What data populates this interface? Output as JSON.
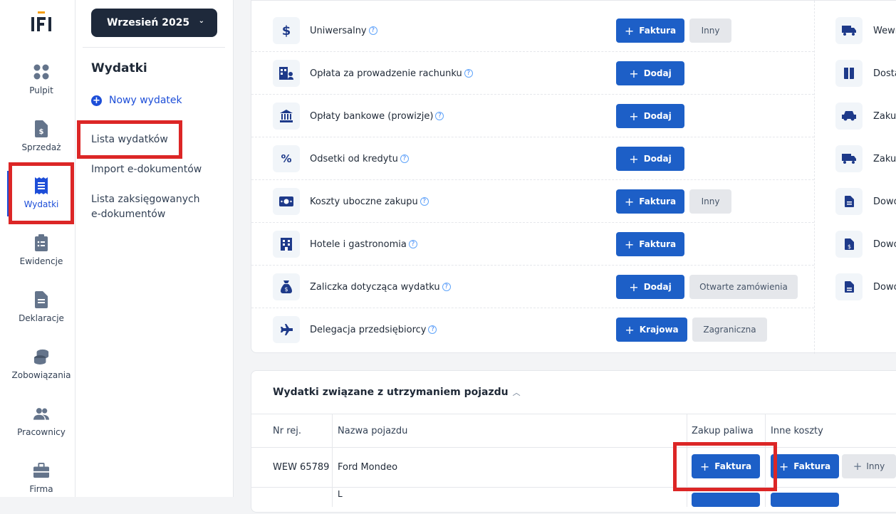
{
  "app": {
    "logo_text": "IFI"
  },
  "colors": {
    "primary": "#1d5fc7",
    "highlight": "#dc2626",
    "dark": "#1e293b"
  },
  "rail": [
    {
      "label": "Pulpit",
      "icon": "dashboard-icon"
    },
    {
      "label": "Sprzedaż",
      "icon": "invoice-dollar-icon"
    },
    {
      "label": "Wydatki",
      "icon": "receipt-icon",
      "active": true
    },
    {
      "label": "Ewidencje",
      "icon": "clipboard-list-icon"
    },
    {
      "label": "Deklaracje",
      "icon": "document-icon"
    },
    {
      "label": "Zobowiązania",
      "icon": "coins-icon"
    },
    {
      "label": "Pracownicy",
      "icon": "users-icon"
    },
    {
      "label": "Firma",
      "icon": "briefcase-icon"
    }
  ],
  "subnav": {
    "month": "Wrzesień 2025",
    "title": "Wydatki",
    "new_expense": "Nowy wydatek",
    "links": [
      "Lista wydatków",
      "Import e-dokumentów",
      "Lista zaksięgowanych e-dokumentów"
    ]
  },
  "expense_types": [
    {
      "name": "Uniwersalny",
      "icon": "dollar-icon",
      "buttons": [
        "Faktura",
        "Inny"
      ]
    },
    {
      "name": "Opłata za prowadzenie rachunku",
      "icon": "building-user-icon",
      "buttons": [
        "Dodaj"
      ]
    },
    {
      "name": "Opłaty bankowe (prowizje)",
      "icon": "bank-icon",
      "buttons": [
        "Dodaj"
      ]
    },
    {
      "name": "Odsetki od kredytu",
      "icon": "percent-icon",
      "buttons": [
        "Dodaj"
      ]
    },
    {
      "name": "Koszty uboczne zakupu",
      "icon": "money-bill-icon",
      "buttons": [
        "Faktura",
        "Inny"
      ]
    },
    {
      "name": "Hotele i gastronomia",
      "icon": "hotel-icon",
      "buttons": [
        "Faktura"
      ]
    },
    {
      "name": "Zaliczka dotycząca wydatku",
      "icon": "money-bag-icon",
      "buttons": [
        "Dodaj",
        "Otwarte zamówienia"
      ]
    },
    {
      "name": "Delegacja przedsiębiorcy",
      "icon": "plane-icon",
      "buttons": [
        "Krajowa",
        "Zagraniczna"
      ]
    }
  ],
  "right_column": [
    {
      "name": "Wewn",
      "icon": "truck-fast-icon"
    },
    {
      "name": "Dosta",
      "icon": "box-icon"
    },
    {
      "name": "Zakup",
      "icon": "car-icon"
    },
    {
      "name": "Zakup",
      "icon": "truck-icon"
    },
    {
      "name": "Dowó",
      "icon": "file-lines-icon"
    },
    {
      "name": "Dowó",
      "icon": "file-dollar-icon"
    },
    {
      "name": "Dowó",
      "icon": "file-icon"
    }
  ],
  "vehicles": {
    "title": "Wydatki związane z utrzymaniem pojazdu",
    "columns": [
      "Nr rej.",
      "Nazwa pojazdu",
      "Zakup paliwa",
      "Inne koszty"
    ],
    "rows": [
      {
        "reg": "WEW 65789",
        "name": "Ford Mondeo",
        "fuel_btn": "Faktura",
        "other_btn": "Faktura",
        "other_btn2": "Inny"
      }
    ]
  }
}
